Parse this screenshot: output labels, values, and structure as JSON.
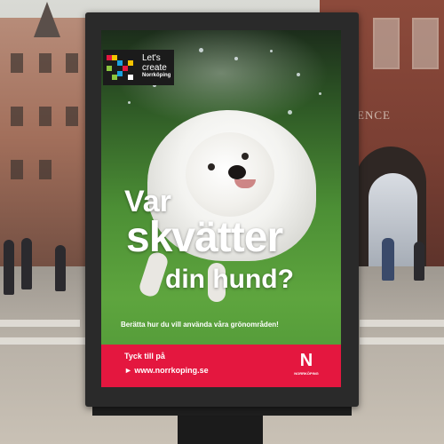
{
  "scene": {
    "store_sign": "ENCE"
  },
  "poster": {
    "logo": {
      "text": "Let's create",
      "sub": "Norrköping"
    },
    "headline": {
      "line1": "Var",
      "line2": "skvätter",
      "line3": "din hund?"
    },
    "subline": "Berätta hur du vill använda våra grönområden!",
    "footer": {
      "label": "Tyck till på",
      "url": "► www.norrkoping.se",
      "logo_mark": "N",
      "logo_text": "NORRKÖPING"
    }
  },
  "colors": {
    "footer_red": "#e4173f",
    "grass_green": "#5ea53e",
    "frame": "#2a2a2a"
  }
}
